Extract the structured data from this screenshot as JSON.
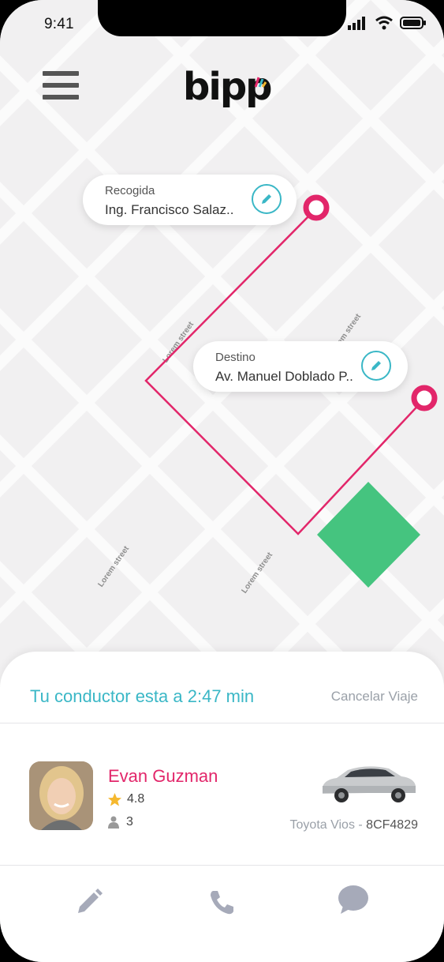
{
  "status_bar": {
    "time": "9:41"
  },
  "header": {
    "logo_text": "bipp"
  },
  "map": {
    "streets": [
      "Lorem street",
      "Lorem street",
      "Lorem street",
      "Lorem street"
    ],
    "route_color": "#e2266a",
    "destination_zone_color": "#45c47f"
  },
  "pickup": {
    "label": "Recogida",
    "value": "Ing. Francisco Salaz.."
  },
  "destination": {
    "label": "Destino",
    "value": "Av. Manuel Doblado P.."
  },
  "trip": {
    "eta_text": "Tu conductor esta a 2:47 min",
    "cancel_label": "Cancelar Viaje"
  },
  "driver": {
    "name": "Evan Guzman",
    "rating": "4.8",
    "seats": "3",
    "vehicle_model": "Toyota Vios",
    "vehicle_separator": " - ",
    "plate": "8CF4829"
  },
  "tabs": [
    {
      "icon": "pencil-icon"
    },
    {
      "icon": "phone-icon"
    },
    {
      "icon": "chat-bubble-icon"
    }
  ],
  "colors": {
    "accent": "#3ab7c6",
    "brand": "#e2266a"
  }
}
